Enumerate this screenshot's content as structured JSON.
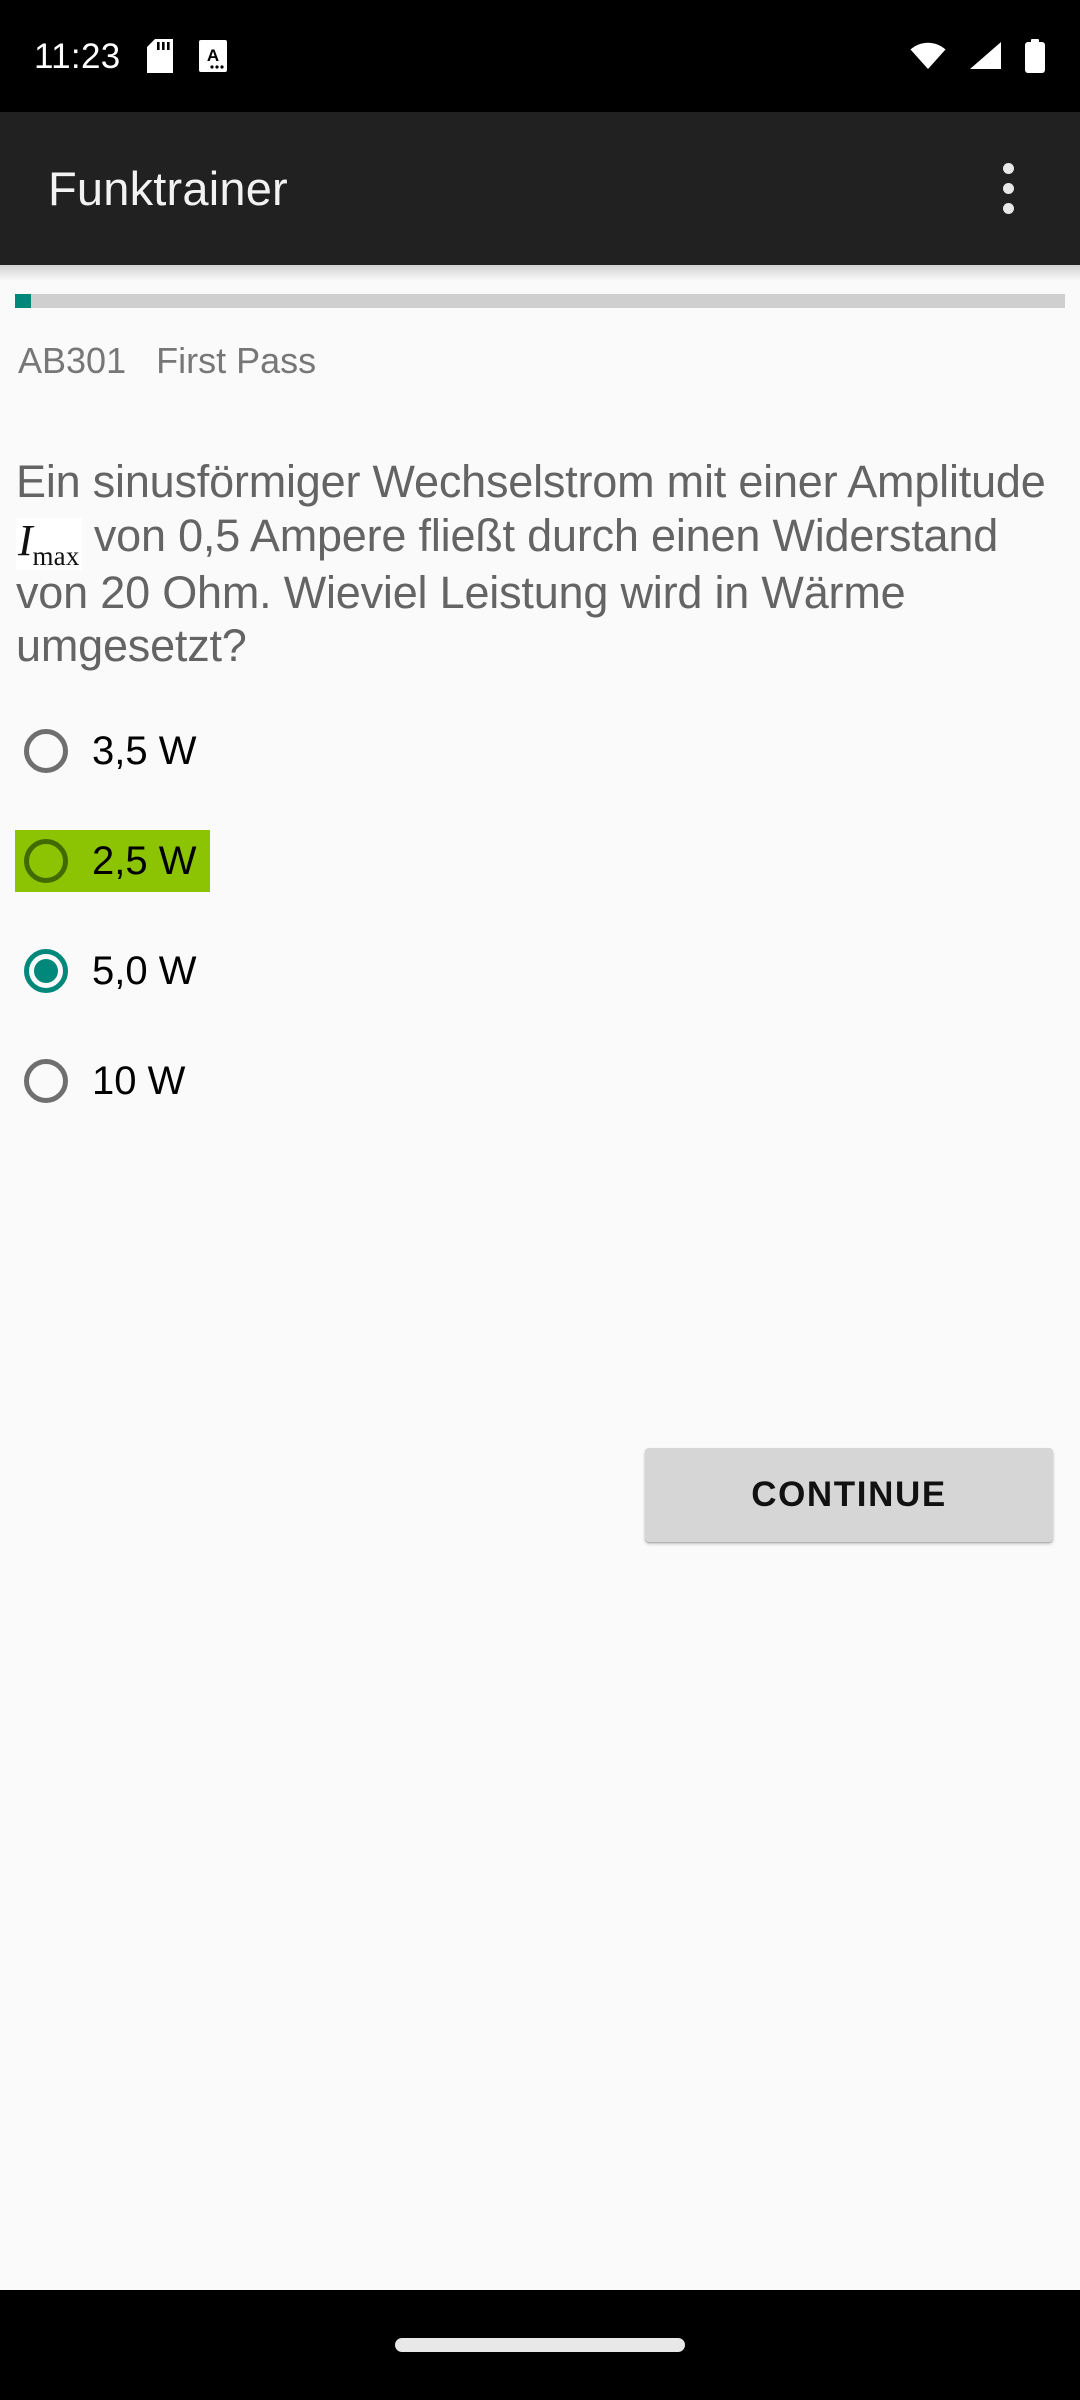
{
  "status_bar": {
    "time": "11:23",
    "left_icons": [
      "sd-card-icon",
      "automation-doc-icon"
    ],
    "right_icons": [
      "wifi-icon",
      "cellular-signal-icon",
      "battery-icon"
    ],
    "background_color": "#000000"
  },
  "app_bar": {
    "title": "Funktrainer",
    "overflow_menu_icon": "more-vert-icon",
    "background_color": "#212121",
    "title_color": "#f2f2f2"
  },
  "progress": {
    "percent": 1.5,
    "track_color": "#cfcfcf",
    "fill_color": "#00897b"
  },
  "meta": {
    "question_id": "AB301",
    "pass_label": "First Pass",
    "text_color": "#777777"
  },
  "question": {
    "text_part_1": "Ein sinusförmiger Wechselstrom mit einer Amplitude ",
    "formula_symbol": "I",
    "formula_subscript": "max",
    "text_part_2": " von 0,5 Ampere fließt durch einen Widerstand von 20 Ohm. Wieviel Leistung wird in Wärme umgesetzt?",
    "text_color": "#646464"
  },
  "options": [
    {
      "label": "3,5 W",
      "state": "unselected"
    },
    {
      "label": "2,5 W",
      "state": "correct"
    },
    {
      "label": "5,0 W",
      "state": "selected"
    },
    {
      "label": "10 W",
      "state": "unselected"
    }
  ],
  "colors": {
    "correct_highlight": "#8cc303",
    "correct_ring": "#3f6b00",
    "selected_accent": "#00897b",
    "unselected_ring": "#6f6f6f",
    "page_background": "#fafafa"
  },
  "continue_button": {
    "label": "CONTINUE",
    "background_color": "#d6d6d6"
  },
  "nav_bar": {
    "gesture_handle": "home-gesture-pill",
    "background_color": "#000000"
  }
}
